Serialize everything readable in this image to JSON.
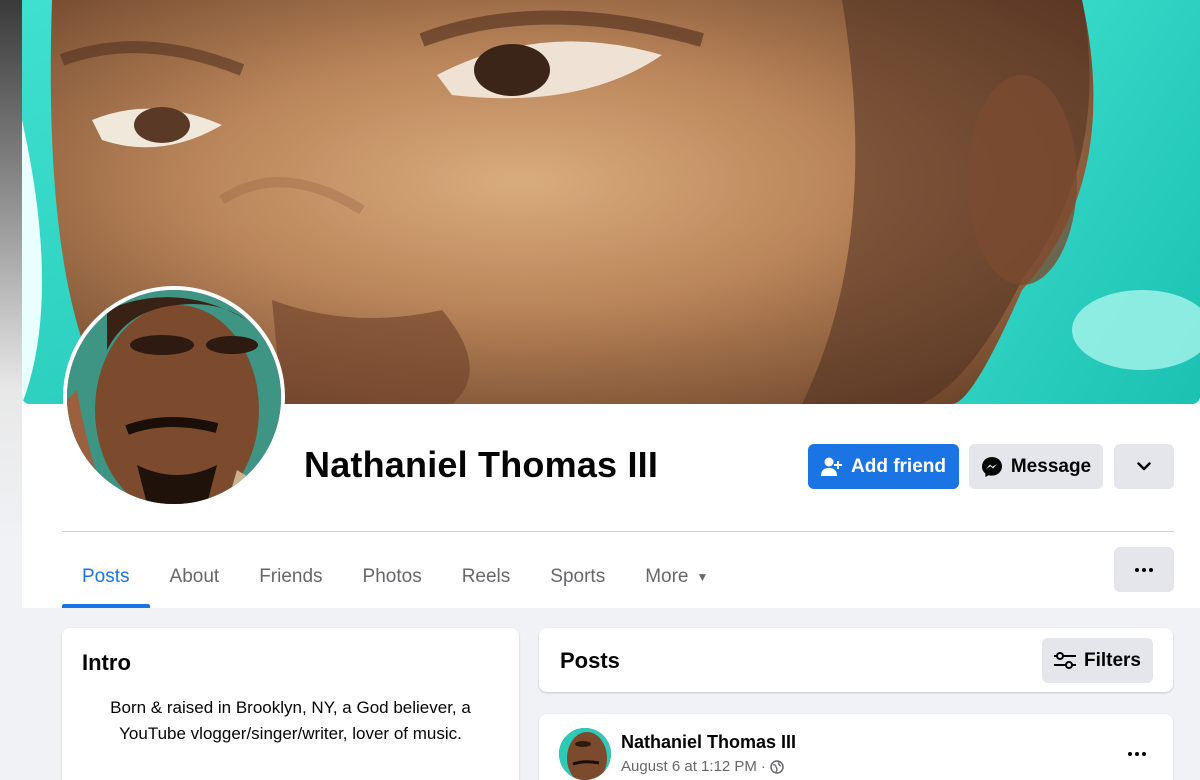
{
  "profile": {
    "name": "Nathaniel Thomas III"
  },
  "actions": {
    "add_friend": "Add friend",
    "message": "Message"
  },
  "tabs": [
    {
      "label": "Posts",
      "active": true
    },
    {
      "label": "About"
    },
    {
      "label": "Friends"
    },
    {
      "label": "Photos"
    },
    {
      "label": "Reels"
    },
    {
      "label": "Sports"
    },
    {
      "label": "More"
    }
  ],
  "intro": {
    "title": "Intro",
    "bio": "Born & raised in Brooklyn, NY, a God believer, a YouTube vlogger/singer/writer, lover of music."
  },
  "posts": {
    "title": "Posts",
    "filters_label": "Filters",
    "items": [
      {
        "author": "Nathaniel Thomas III",
        "time": "August 6 at 1:12 PM",
        "audience_icon": "globe-icon"
      }
    ]
  },
  "colors": {
    "accent": "#1b74e4",
    "secondary_button": "#e4e6eb",
    "background": "#f0f2f5",
    "muted_text": "#65676b"
  }
}
